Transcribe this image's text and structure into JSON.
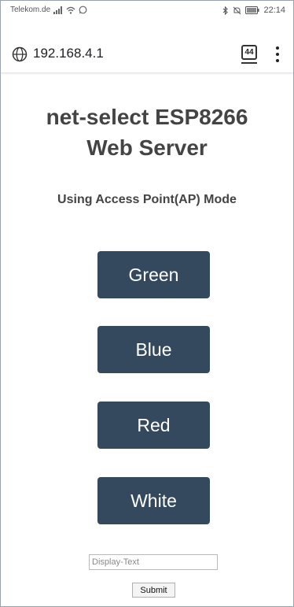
{
  "status_bar": {
    "carrier": "Telekom.de",
    "time": "22:14"
  },
  "browser": {
    "url": "192.168.4.1",
    "tab_count": "44"
  },
  "page": {
    "title_line1": "net-select ESP8266",
    "title_line2": "Web Server",
    "subtitle": "Using Access Point(AP) Mode",
    "buttons": [
      {
        "label": "Green"
      },
      {
        "label": "Blue"
      },
      {
        "label": "Red"
      },
      {
        "label": "White"
      }
    ],
    "text_input": {
      "placeholder": "Display-Text",
      "value": ""
    },
    "submit_label": "Submit"
  },
  "colors": {
    "button_bg": "#34495e",
    "button_text": "#ffffff",
    "heading_text": "#444444"
  }
}
